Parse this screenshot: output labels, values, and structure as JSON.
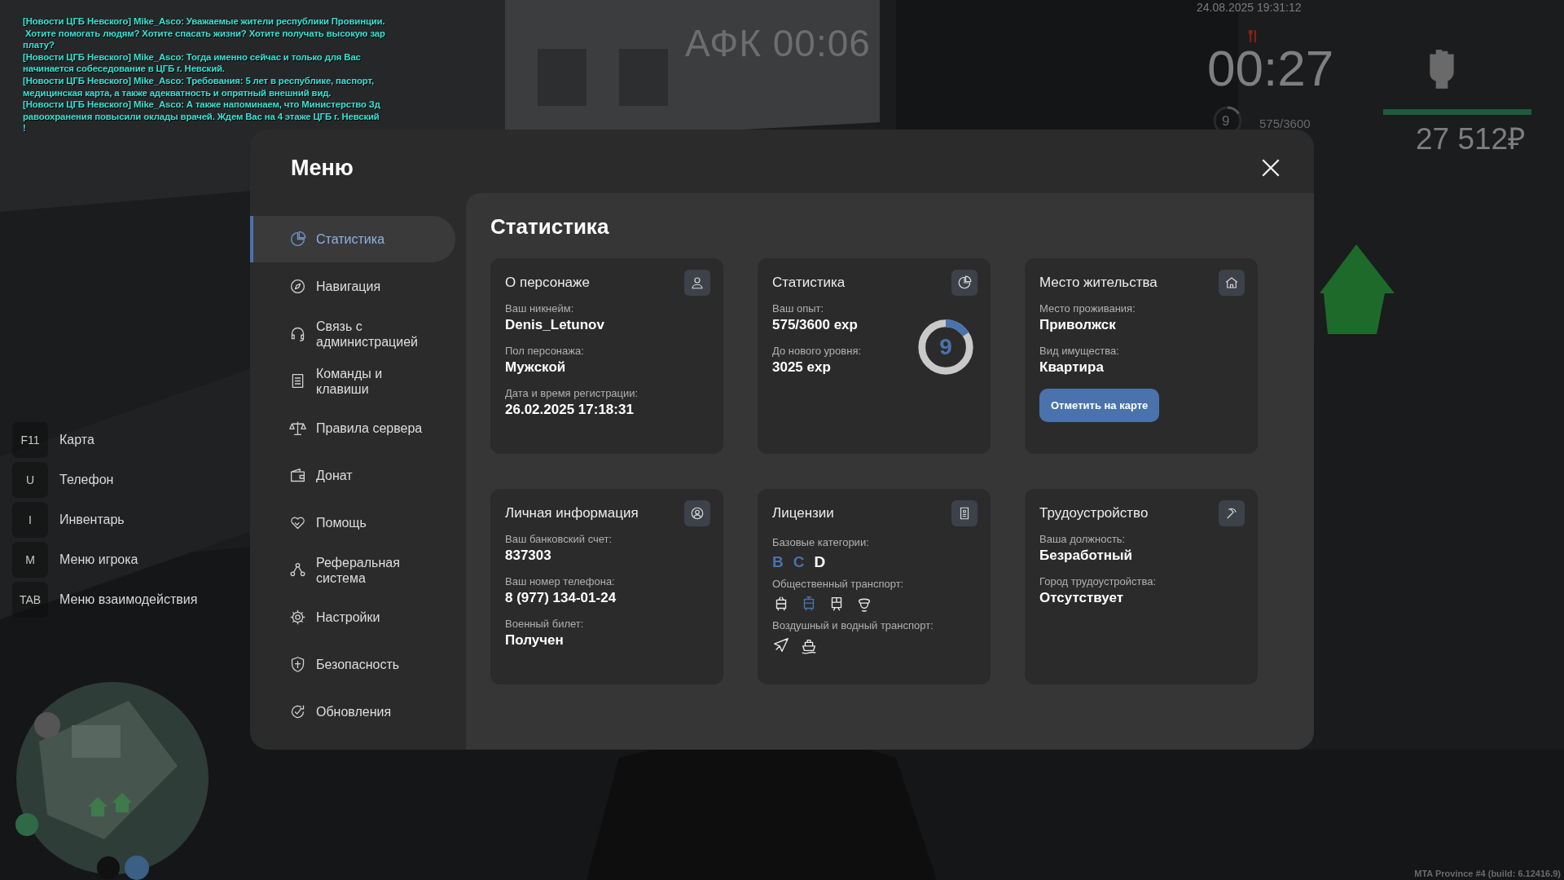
{
  "chat": {
    "lines": [
      "[Новости ЦГБ Невского] Mike_Asco: Уважаемые жители республики Провинции.",
      " Хотите помогать людям? Хотите спасать жизни? Хотите получать высокую зар",
      "плату?",
      "[Новости ЦГБ Невского] Mike_Asco: Тогда именно сейчас и только для Вас",
      "начинается собеседование в ЦГБ г. Невский.",
      "[Новости ЦГБ Невского] Mike_Asco: Требования: 5 лет в республике, паспорт,",
      "медицинская карта, а также адекватность и опрятный внешний вид.",
      "[Новости ЦГБ Невского] Mike_Asco: А также напоминаем, что Министерство Зд",
      "равоохранения повысили оклады врачей. Ждем Вас на 4 этаже ЦГБ г. Невский",
      "!"
    ]
  },
  "afk": "АФК 00:06",
  "hud": {
    "datetime": "24.08.2025 19:31:12",
    "timer": "00:27",
    "level_ring": {
      "value": "9",
      "level": 0.16
    },
    "exp": "575/3600",
    "health": {
      "level": 1
    },
    "money": "27 512₽"
  },
  "hotkeys": [
    {
      "key": "F11",
      "label": "Карта"
    },
    {
      "key": "U",
      "label": "Телефон"
    },
    {
      "key": "I",
      "label": "Инвентарь"
    },
    {
      "key": "M",
      "label": "Меню игрока"
    },
    {
      "key": "TAB",
      "label": "Меню взаимодействия"
    }
  ],
  "menu": {
    "title": "Меню",
    "sidebar": [
      {
        "label": "Статистика",
        "selected": true
      },
      {
        "label": "Навигация",
        "selected": false
      },
      {
        "label": "Связь с администрацией",
        "selected": false
      },
      {
        "label": "Команды и клавиши",
        "selected": false
      },
      {
        "label": "Правила сервера",
        "selected": false
      },
      {
        "label": "Донат",
        "selected": false
      },
      {
        "label": "Помощь",
        "selected": false
      },
      {
        "label": "Реферальная система",
        "selected": false
      },
      {
        "label": "Настройки",
        "selected": false
      },
      {
        "label": "Безопасность",
        "selected": false
      },
      {
        "label": "Обновления",
        "selected": false
      }
    ],
    "content": {
      "title": "Статистика",
      "cards": [
        {
          "kind": "fields",
          "title": "О персонаже",
          "fields": [
            {
              "label": "Ваш никнейм:",
              "value": "Denis_Letunov"
            },
            {
              "label": "Пол персонажа:",
              "value": "Мужской"
            },
            {
              "label": "Дата и время регистрации:",
              "value": "26.02.2025 17:18:31"
            }
          ]
        },
        {
          "kind": "stats",
          "title": "Статистика",
          "fields": [
            {
              "label": "Ваш опыт:",
              "value": "575/3600 exp"
            },
            {
              "label": "До нового уровня:",
              "value": "3025 exp"
            }
          ],
          "ring": {
            "value": "9",
            "level": 0.16
          }
        },
        {
          "kind": "residence",
          "title": "Место жительства",
          "fields": [
            {
              "label": "Место проживания:",
              "value": "Приволжск"
            },
            {
              "label": "Вид имущества:",
              "value": "Квартира"
            }
          ],
          "button": "Отметить на карте"
        },
        {
          "kind": "fields",
          "title": "Личная информация",
          "fields": [
            {
              "label": "Ваш банковский счет:",
              "value": "837303"
            },
            {
              "label": "Ваш номер телефона:",
              "value": "8 (977) 134-01-24"
            },
            {
              "label": "Военный билет:",
              "value": "Получен"
            }
          ]
        },
        {
          "kind": "licenses",
          "title": "Лицензии",
          "groups": [
            {
              "label": "Базовые категории:",
              "kind": "letters",
              "items": [
                {
                  "label": "B",
                  "active": true
                },
                {
                  "label": "C",
                  "active": true
                },
                {
                  "label": "D",
                  "active": false
                }
              ]
            },
            {
              "label": "Общественный транспорт:",
              "kind": "public",
              "items": [
                {
                  "active": false
                },
                {
                  "active": true
                },
                {
                  "active": false
                },
                {
                  "active": false
                }
              ]
            },
            {
              "label": "Воздушный и водный транспорт:",
              "kind": "air",
              "items": [
                {
                  "active": false
                },
                {
                  "active": false
                }
              ]
            }
          ]
        },
        {
          "kind": "fields",
          "title": "Трудоустройство",
          "fields": [
            {
              "label": "Ваша должность:",
              "value": "Безработный"
            },
            {
              "label": "Город трудоустройства:",
              "value": "Отсутствует"
            }
          ]
        }
      ]
    }
  },
  "build": "MTA Province #4 (build: 6.12416.9)"
}
